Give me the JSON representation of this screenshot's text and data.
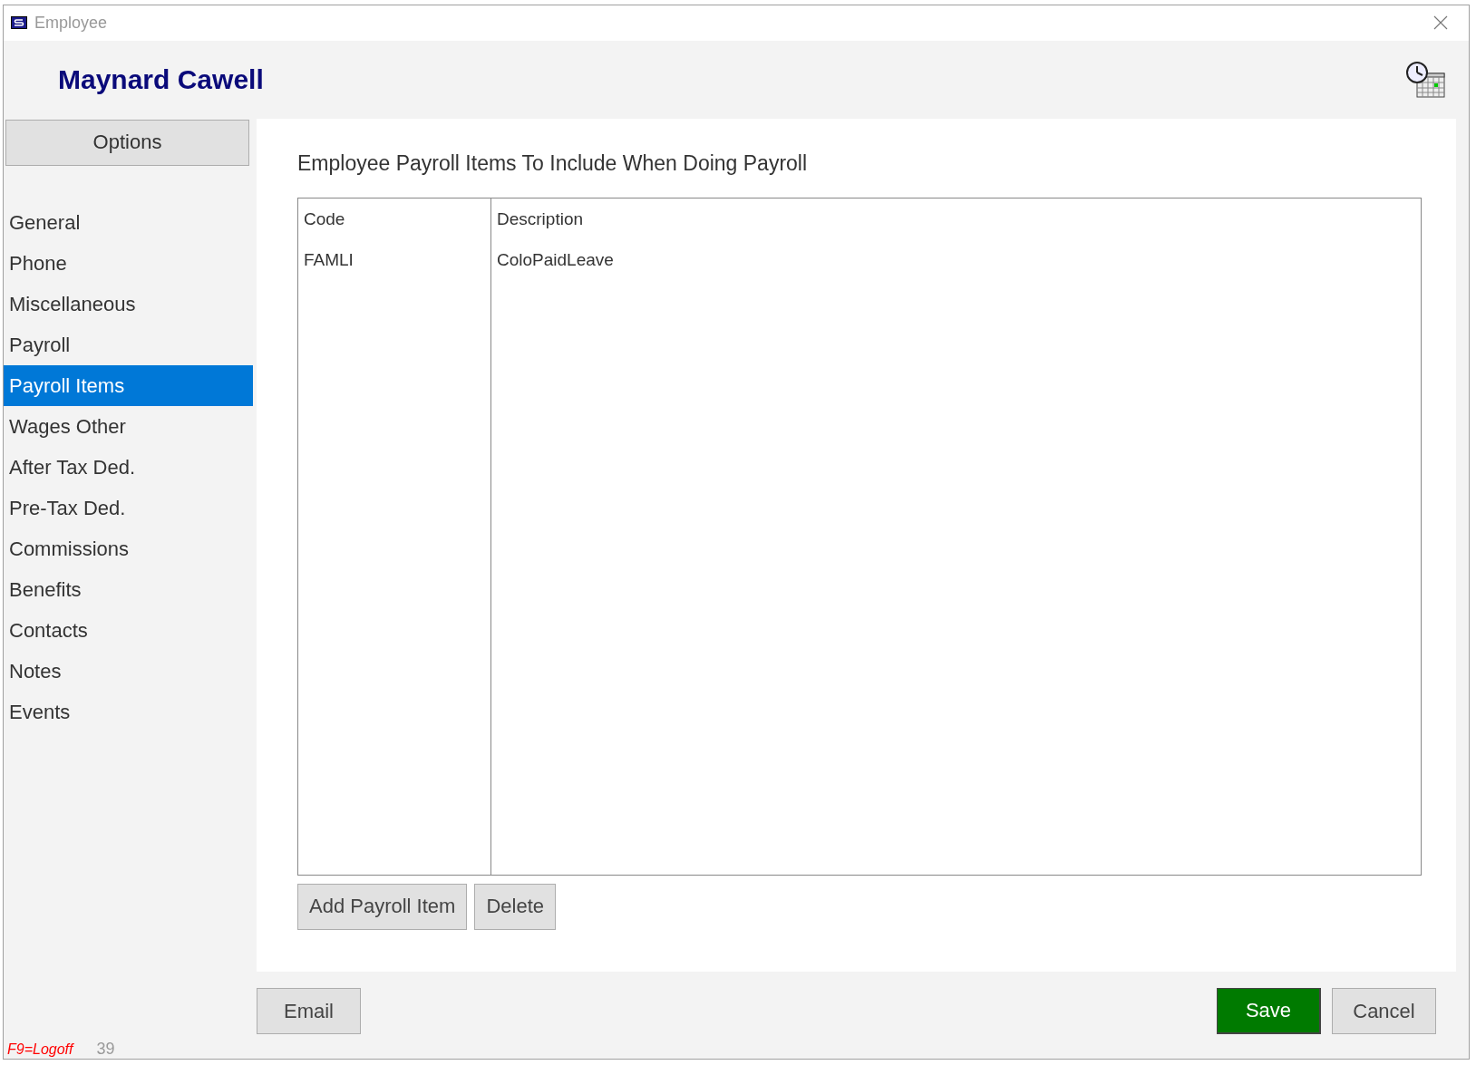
{
  "window": {
    "title": "Employee"
  },
  "header": {
    "name": "Maynard Cawell"
  },
  "sidebar": {
    "options_button": "Options",
    "items": [
      {
        "label": "General",
        "selected": false
      },
      {
        "label": "Phone",
        "selected": false
      },
      {
        "label": "Miscellaneous",
        "selected": false
      },
      {
        "label": "Payroll",
        "selected": false
      },
      {
        "label": "Payroll Items",
        "selected": true
      },
      {
        "label": "Wages Other",
        "selected": false
      },
      {
        "label": "After Tax Ded.",
        "selected": false
      },
      {
        "label": "Pre-Tax Ded.",
        "selected": false
      },
      {
        "label": "Commissions",
        "selected": false
      },
      {
        "label": "Benefits",
        "selected": false
      },
      {
        "label": "Contacts",
        "selected": false
      },
      {
        "label": "Notes",
        "selected": false
      },
      {
        "label": "Events",
        "selected": false
      }
    ]
  },
  "panel": {
    "heading": "Employee Payroll Items To Include When Doing Payroll",
    "table": {
      "columns": [
        "Code",
        "Description"
      ],
      "rows": [
        [
          "FAMLI",
          "ColoPaidLeave"
        ]
      ]
    },
    "buttons": [
      "Add Payroll Item",
      "Delete"
    ]
  },
  "footer": {
    "left_buttons": [
      {
        "label": "Email",
        "kind": "default"
      }
    ],
    "right_buttons": [
      {
        "label": "Save",
        "kind": "primary"
      },
      {
        "label": "Cancel",
        "kind": "default"
      }
    ]
  },
  "status_bar": {
    "shortcut": "F9=Logoff",
    "count": "39"
  }
}
